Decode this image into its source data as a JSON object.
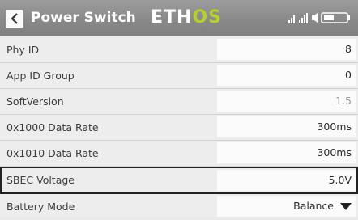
{
  "header": {
    "title": "Power Switch",
    "logo_part1": "ETH",
    "logo_part2": "OS"
  },
  "rows": [
    {
      "label": "Phy ID",
      "value": "8"
    },
    {
      "label": "App ID Group",
      "value": "0"
    },
    {
      "label": "SoftVersion",
      "value": "1.5"
    },
    {
      "label": "0x1000 Data Rate",
      "value": "300ms"
    },
    {
      "label": "0x1010 Data Rate",
      "value": "300ms"
    },
    {
      "label": "SBEC Voltage",
      "value": "5.0V"
    },
    {
      "label": "Battery Mode",
      "value": "Balance"
    }
  ],
  "selected_row": "SBEC Voltage",
  "colors": {
    "logo_accent": "#b6cf2a",
    "header": "#8a8a8a"
  }
}
